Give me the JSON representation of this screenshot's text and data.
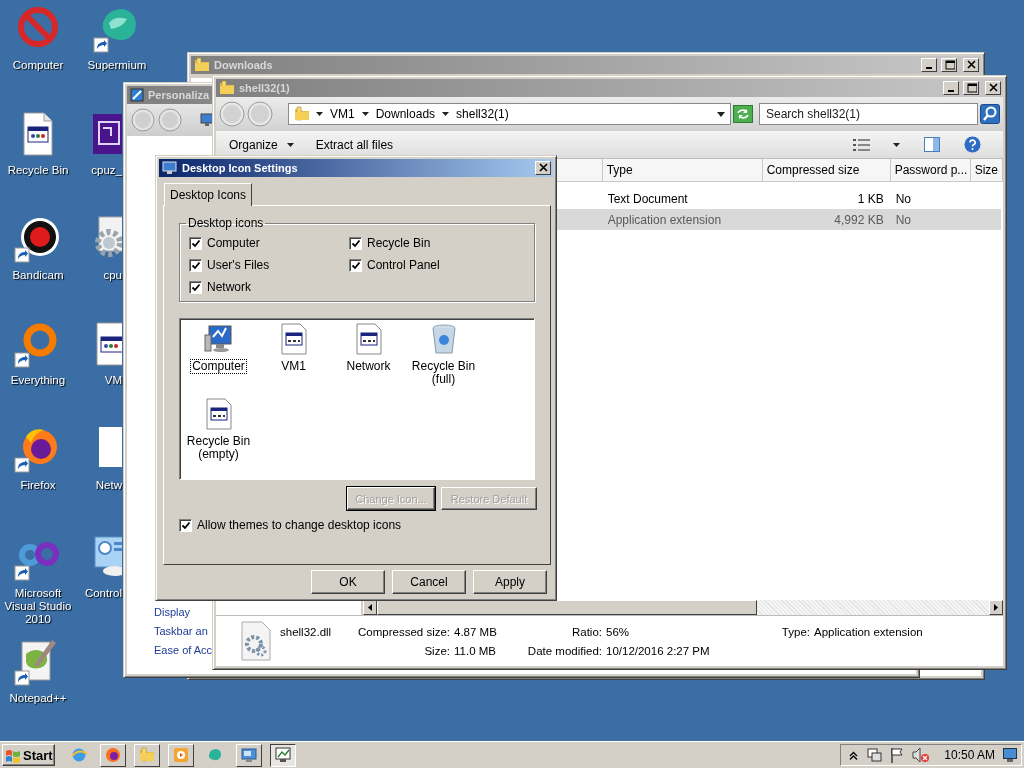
{
  "desktop_icons": [
    {
      "label": "Computer"
    },
    {
      "label": "Recycle Bin"
    },
    {
      "label": "Bandicam"
    },
    {
      "label": "Everything"
    },
    {
      "label": "Firefox"
    },
    {
      "label": "Microsoft Visual Studio 2010"
    },
    {
      "label": "Notepad++"
    },
    {
      "label": "Supermium"
    },
    {
      "label": "cpuz_"
    },
    {
      "label": "cpu"
    },
    {
      "label": "VM"
    },
    {
      "label": "Netw"
    },
    {
      "label": "Control"
    }
  ],
  "windows": {
    "downloads": {
      "title": "Downloads"
    },
    "personalization": {
      "title": "Personaliza",
      "links": [
        "Display",
        "Taskbar an",
        "Ease of Acc"
      ]
    },
    "explorer": {
      "title": "shell32(1)",
      "breadcrumb": [
        "VM1",
        "Downloads",
        "shell32(1)"
      ],
      "search": {
        "placeholder": "Search shell32(1)"
      },
      "commands": [
        "Organize",
        "Extract all files"
      ],
      "columns": [
        "Type",
        "Compressed size",
        "Password p...",
        "Size"
      ],
      "rows": [
        {
          "cells": [
            "Text Document",
            "1 KB",
            "No"
          ],
          "selected": false
        },
        {
          "cells": [
            "Application extension",
            "4,992 KB",
            "No"
          ],
          "selected": true
        }
      ],
      "details": {
        "name": "shell32.dll",
        "fields": [
          {
            "label": "Compressed size:",
            "value": "4.87 MB"
          },
          {
            "label": "Ratio:",
            "value": "56%"
          },
          {
            "label": "Type:",
            "value": "Application extension"
          },
          {
            "label": "Size:",
            "value": "11.0 MB"
          },
          {
            "label": "Date modified:",
            "value": "10/12/2016 2:27 PM"
          }
        ]
      }
    },
    "dialog": {
      "title": "Desktop Icon Settings",
      "tabs": [
        {
          "label": "Desktop Icons",
          "selected": true
        }
      ],
      "group": "Desktop icons",
      "checkboxes": [
        {
          "label": "Computer",
          "checked": true
        },
        {
          "label": "Recycle Bin",
          "checked": true
        },
        {
          "label": "User's Files",
          "checked": true
        },
        {
          "label": "Control Panel",
          "checked": true
        },
        {
          "label": "Network",
          "checked": true
        }
      ],
      "icons": [
        {
          "label": "Computer",
          "selected": true
        },
        {
          "label": "VM1",
          "selected": false
        },
        {
          "label": "Network",
          "selected": false
        },
        {
          "label": "Recycle Bin (full)",
          "selected": false
        },
        {
          "label": "Recycle Bin (empty)",
          "selected": false
        }
      ],
      "icon_buttons": [
        {
          "label": "Change Icon...",
          "disabled": true,
          "default": true
        },
        {
          "label": "Restore Default",
          "disabled": true,
          "default": false
        }
      ],
      "allow_themes": {
        "label": "Allow themes to change desktop icons",
        "checked": true
      },
      "buttons": [
        "OK",
        "Cancel",
        "Apply"
      ]
    }
  },
  "taskbar": {
    "start": "Start",
    "time": "10:50 AM",
    "buttons": [
      {
        "kind": "quick",
        "selected": false
      },
      {
        "kind": "task",
        "selected": false
      },
      {
        "kind": "task",
        "selected": false
      },
      {
        "kind": "task",
        "selected": false
      },
      {
        "kind": "quick",
        "selected": false
      },
      {
        "kind": "task",
        "selected": false
      },
      {
        "kind": "task",
        "selected": true
      }
    ]
  }
}
